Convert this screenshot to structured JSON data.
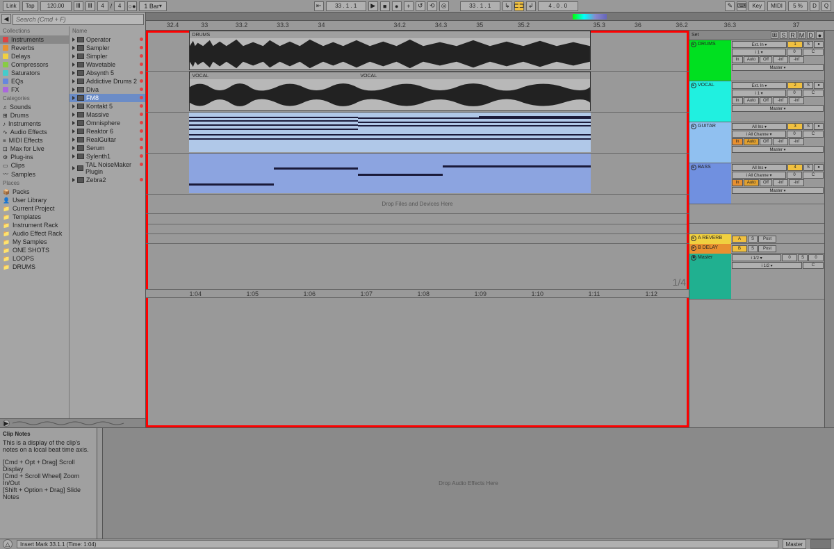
{
  "toolbar": {
    "link": "Link",
    "tap": "Tap",
    "tempo": "120.00",
    "sig_num": "4",
    "sig_den": "4",
    "bar": "1 Bar",
    "position": "33 . 1 . 1",
    "loop_pos": "33 . 1 . 1",
    "loop_len": "4 . 0 . 0",
    "key": "Key",
    "midi": "MIDI",
    "cpu": "5 %",
    "d": "D",
    "q": "Q"
  },
  "search": {
    "placeholder": "Search (Cmd + F)"
  },
  "collections": {
    "header": "Collections",
    "items": [
      {
        "name": "Instruments",
        "color": "#d44"
      },
      {
        "name": "Reverbs",
        "color": "#e89030"
      },
      {
        "name": "Delays",
        "color": "#f0d040"
      },
      {
        "name": "Compressors",
        "color": "#8c4"
      },
      {
        "name": "Saturators",
        "color": "#4cc"
      },
      {
        "name": "EQs",
        "color": "#68d"
      },
      {
        "name": "FX",
        "color": "#a6d"
      }
    ]
  },
  "categories": {
    "header": "Categories",
    "items": [
      "Sounds",
      "Drums",
      "Instruments",
      "Audio Effects",
      "MIDI Effects",
      "Max for Live",
      "Plug-ins",
      "Clips",
      "Samples"
    ]
  },
  "places": {
    "header": "Places",
    "items": [
      "Packs",
      "User Library",
      "Current Project",
      "Templates",
      "Instrument Rack",
      "Audio Effect Rack",
      "My Samples",
      "ONE SHOTS",
      "LOOPS",
      "DRUMS"
    ]
  },
  "devices": {
    "header": "Name",
    "items": [
      "Operator",
      "Sampler",
      "Simpler",
      "Wavetable",
      "Absynth 5",
      "Addictive Drums 2",
      "Diva",
      "FM8",
      "Kontakt 5",
      "Massive",
      "Omnisphere",
      "Reaktor 6",
      "RealGuitar",
      "Serum",
      "Sylenth1",
      "TAL NoiseMaker Plugin",
      "Zebra2"
    ],
    "selected": "FM8"
  },
  "ruler": {
    "bars": [
      "32.4",
      "33",
      "33.2",
      "33.3",
      "34",
      "34.2",
      "34.3",
      "35",
      "35.2",
      "35.3",
      "36",
      "36.2",
      "36.3",
      "37"
    ],
    "beats": [
      "1:04",
      "1:05",
      "1:06",
      "1:07",
      "1:08",
      "1:09",
      "1:10",
      "1:11",
      "1:12"
    ]
  },
  "tracks": [
    {
      "name": "DRUMS",
      "color": "#00e020",
      "type": "audio",
      "io": "Ext. In",
      "ch": "1",
      "send": "1",
      "mon": "In Auto Off",
      "out": "Master",
      "inf1": "-inf",
      "inf2": "-inf",
      "s": "S",
      "c": "C"
    },
    {
      "name": "VOCAL",
      "color": "#20f0e0",
      "type": "audio",
      "io": "Ext. In",
      "ch": "1",
      "send": "2",
      "mon": "In Auto Off",
      "out": "Master",
      "inf1": "-inf",
      "inf2": "-inf",
      "s": "S",
      "c": "C"
    },
    {
      "name": "GUITAR",
      "color": "#90c0f0",
      "type": "midi",
      "io": "All Ins",
      "ch": "All Channe",
      "send": "3",
      "mon": "In Auto Off",
      "out": "Master",
      "inf1": "-inf",
      "inf2": "-inf",
      "s": "S",
      "c": "C"
    },
    {
      "name": "BASS",
      "color": "#7090e0",
      "type": "midi",
      "io": "All Ins",
      "ch": "All Channe",
      "send": "4",
      "mon": "In Auto Off",
      "out": "Master",
      "inf1": "-inf",
      "inf2": "-inf",
      "s": "S",
      "c": "C"
    }
  ],
  "drop_hint": "Drop Files and Devices Here",
  "returns": [
    {
      "name": "A REVERB",
      "color": "#f0d040",
      "send": "A",
      "s": "S",
      "post": "Post"
    },
    {
      "name": "B DELAY",
      "color": "#e89030",
      "send": "B",
      "s": "S",
      "post": "Post"
    }
  ],
  "master": {
    "name": "Master",
    "color": "#20b090",
    "io1": "1/2",
    "io2": "1/2",
    "send": "0",
    "s": "S",
    "c": "C",
    "zero": "0"
  },
  "set": {
    "label": "Set"
  },
  "signature": "1/4",
  "clip_notes": {
    "title": "Clip Notes",
    "desc": "This is a display of the clip's notes on a local beat time axis.",
    "hint1": "[Cmd + Opt + Drag] Scroll Display",
    "hint2": "[Cmd + Scroll Wheel] Zoom In/Out",
    "hint3": "[Shift + Option + Drag] Slide Notes"
  },
  "device_drop": "Drop Audio Effects Here",
  "status": {
    "text": "Insert Mark 33.1.1 (Time: 1:04)",
    "master": "Master"
  }
}
